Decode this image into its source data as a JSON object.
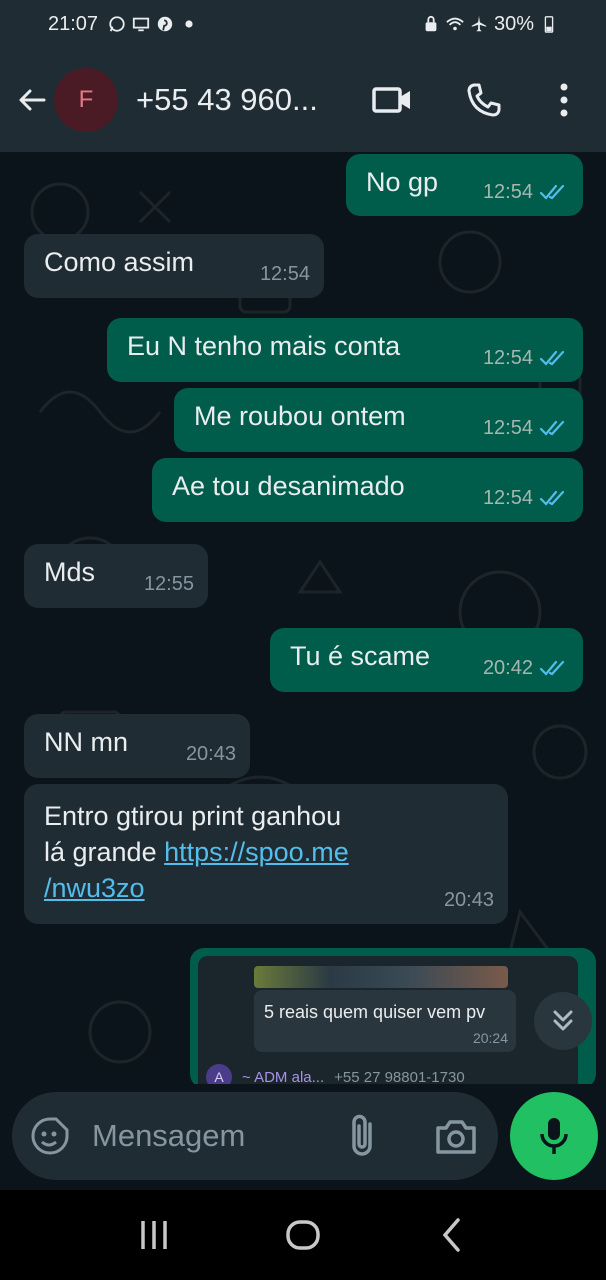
{
  "status_bar": {
    "time": "21:07",
    "battery": "30%",
    "icons": [
      "whatsapp-icon",
      "screen-icon",
      "pinterest-icon",
      "dot-icon",
      "lock-icon",
      "wifi-icon",
      "airplane-icon",
      "battery-icon"
    ]
  },
  "header": {
    "avatar_letter": "F",
    "contact": "+55 43 960...",
    "icons": [
      "back-arrow-icon",
      "video-call-icon",
      "phone-icon",
      "more-vert-icon"
    ]
  },
  "messages": [
    {
      "dir": "out",
      "text": "No gp",
      "time": "12:54",
      "read": true
    },
    {
      "dir": "in",
      "text": "Como assim",
      "time": "12:54"
    },
    {
      "dir": "out",
      "text": "Eu N tenho mais conta",
      "time": "12:54",
      "read": true
    },
    {
      "dir": "out",
      "text": "Me roubou ontem",
      "time": "12:54",
      "read": true
    },
    {
      "dir": "out",
      "text": "Ae tou desanimado",
      "time": "12:54",
      "read": true
    },
    {
      "dir": "in",
      "text": "Mds",
      "time": "12:55"
    },
    {
      "dir": "out",
      "text": "Tu é scame",
      "time": "20:42",
      "read": true
    },
    {
      "dir": "in",
      "text": "NN mn",
      "time": "20:43"
    },
    {
      "dir": "in",
      "text_line1": "Entro gtirou print ganhou",
      "text_line2": "lá grande",
      "link_part1": "https://spoo.me",
      "link_part2": "/nwu3zo",
      "time": "20:43"
    }
  ],
  "forwarded": {
    "preview_text": "5 reais quem quiser vem pv",
    "preview_time": "20:24",
    "sender_avatar": "A",
    "sender_name": "~ ADM ala...",
    "sender_phone": "+55 27 98801-1730"
  },
  "input": {
    "placeholder": "Mensagem"
  },
  "colors": {
    "outgoing_bubble": "#005c4b",
    "incoming_bubble": "#202c33",
    "background": "#0b141a",
    "accent_green": "#21c063",
    "link": "#53bdeb",
    "read_ticks": "#53bdeb"
  }
}
